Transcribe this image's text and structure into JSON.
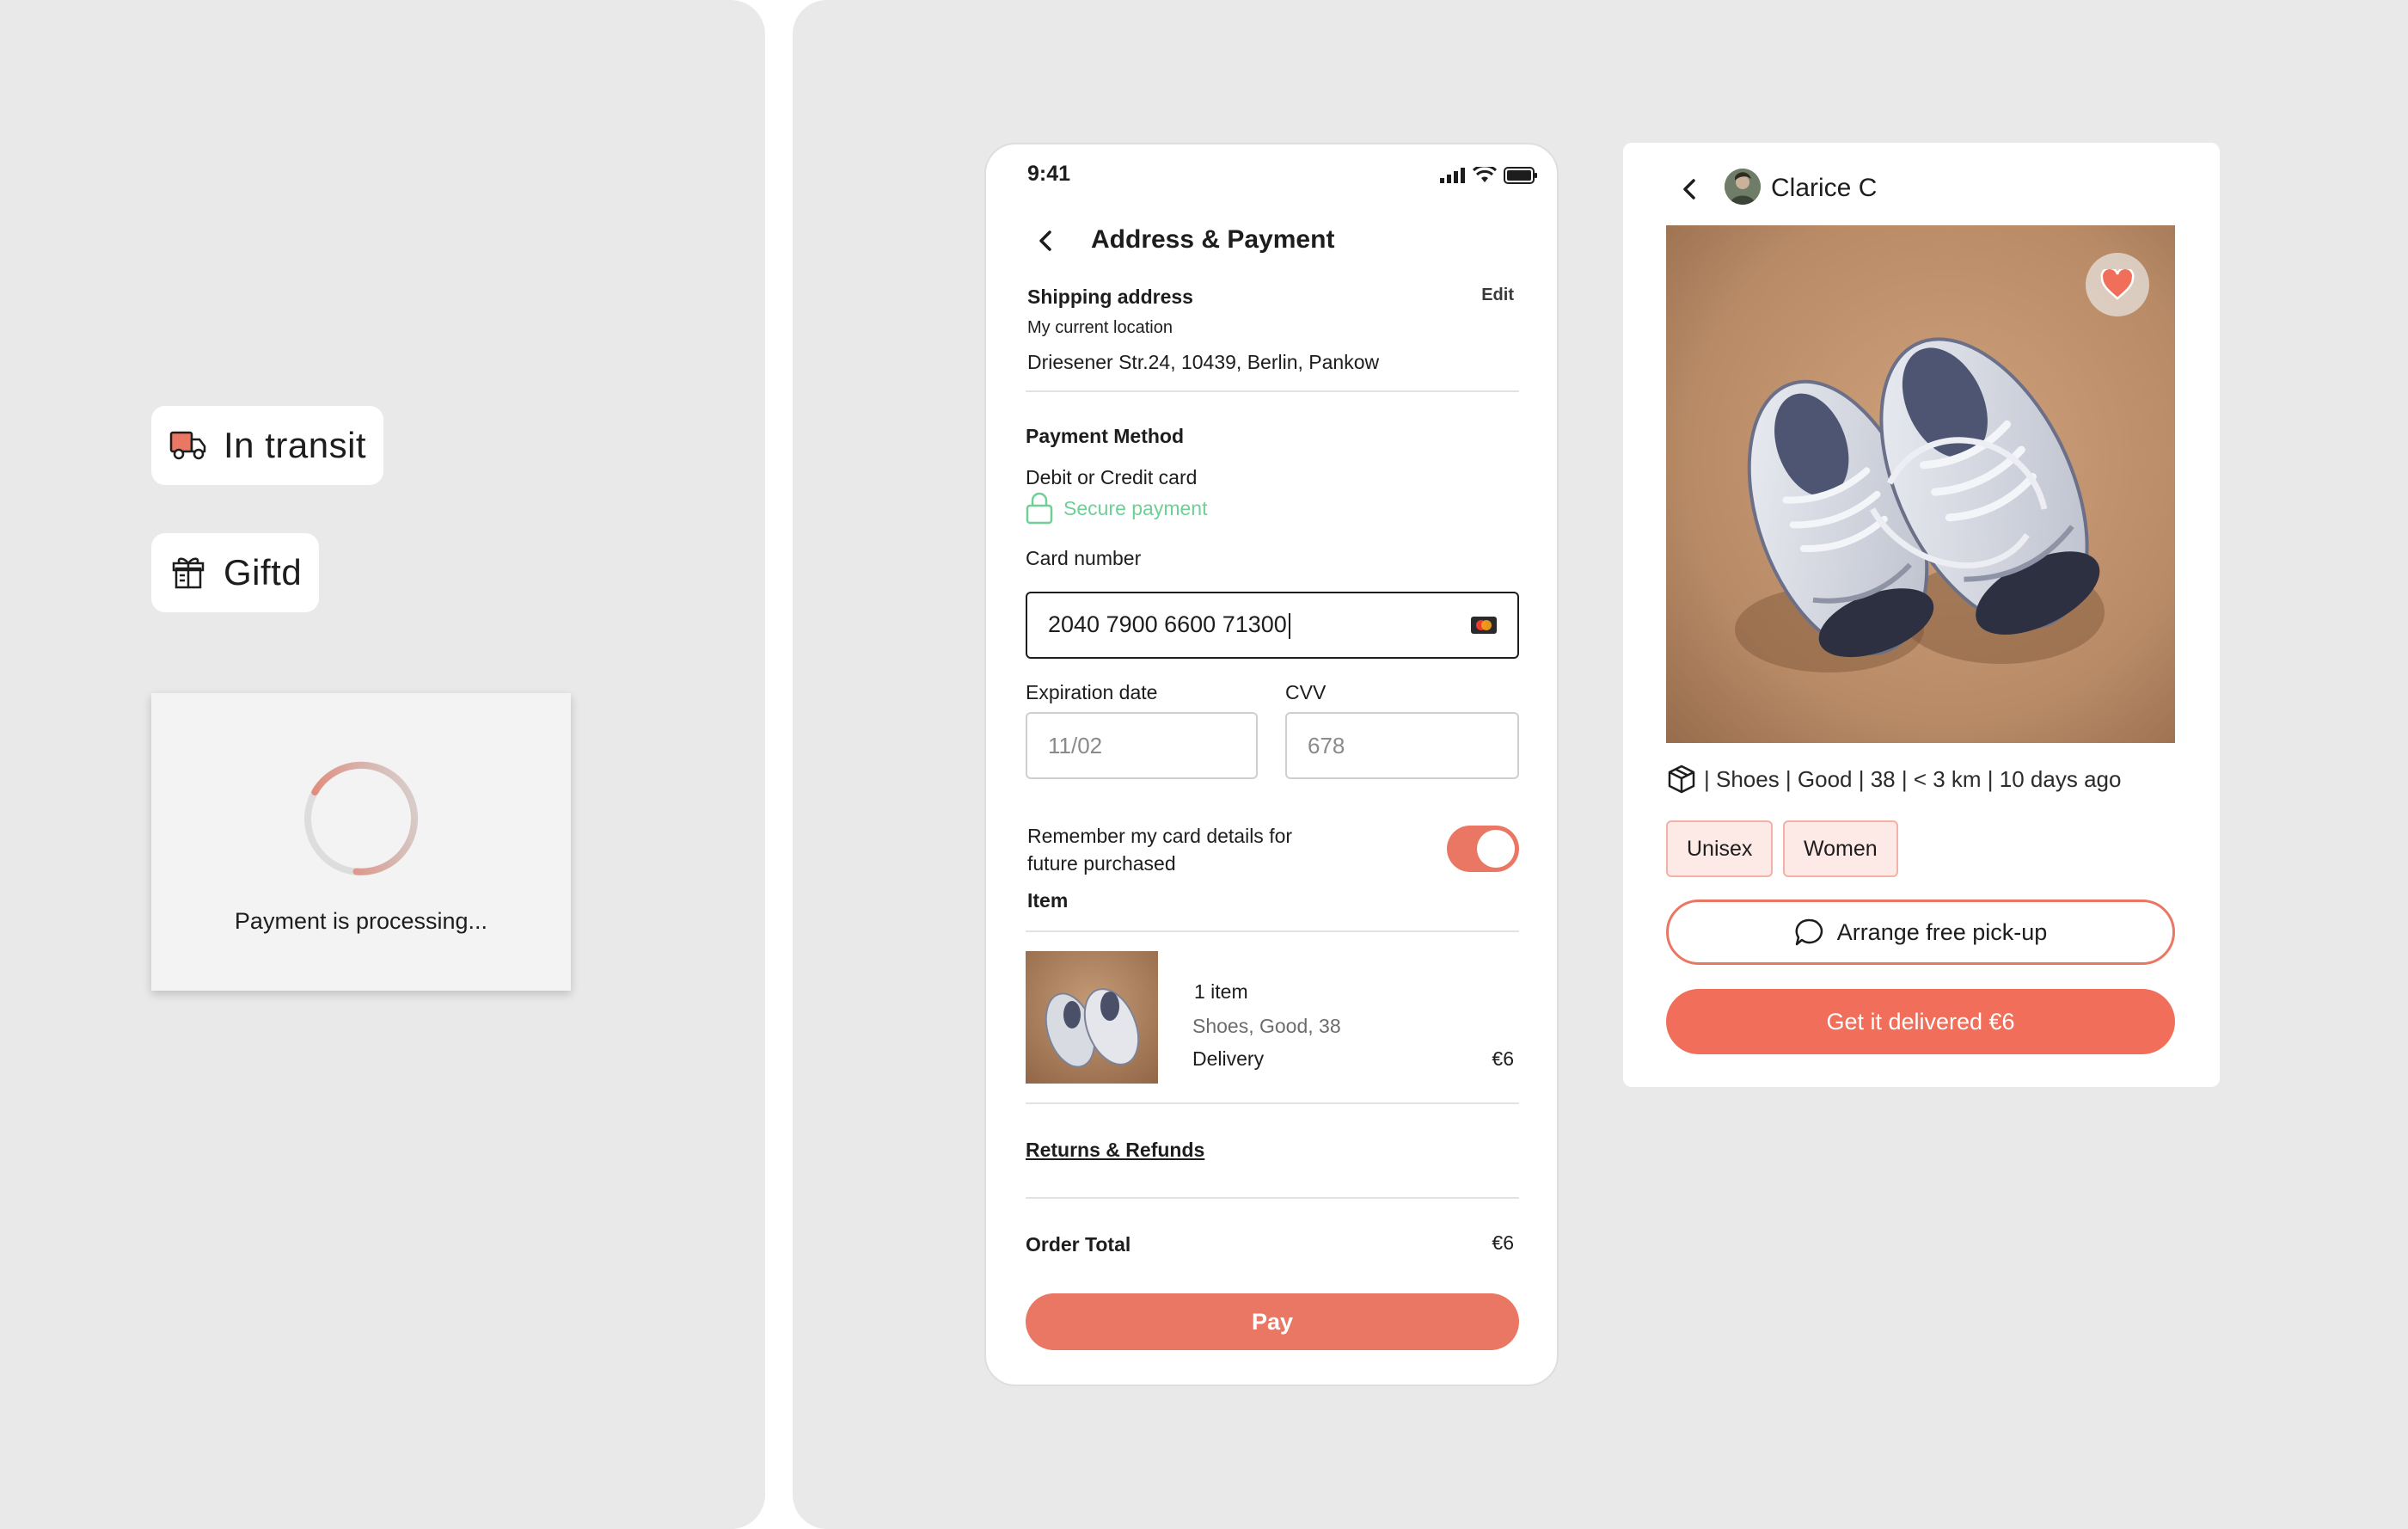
{
  "colors": {
    "background": "#e9e9e9",
    "accent": "#ea7764",
    "accent_strong": "#f16e5a",
    "secure_green": "#6fcf97",
    "tag_bg": "#fde9e5"
  },
  "status_chips": {
    "in_transit": {
      "label": "In transit",
      "icon": "truck-icon"
    },
    "gifted": {
      "label": "Giftd",
      "icon": "gift-icon"
    }
  },
  "processing": {
    "message": "Payment is processing..."
  },
  "phone": {
    "status_bar": {
      "time": "9:41"
    },
    "title": "Address & Payment",
    "shipping": {
      "heading": "Shipping address",
      "edit_label": "Edit",
      "location_label": "My current location",
      "address": "Driesener Str.24, 10439, Berlin, Pankow"
    },
    "payment": {
      "heading": "Payment Method",
      "method": "Debit or Credit card",
      "secure_label": "Secure payment",
      "card_number_label": "Card number",
      "card_number_value": "2040 7900 6600 71300",
      "expiration_label": "Expiration date",
      "expiration_value": "11/02",
      "cvv_label": "CVV",
      "cvv_value": "678",
      "remember_label_line1": "Remember my card details for",
      "remember_label_line2": "future purchased",
      "remember_enabled": true
    },
    "item": {
      "heading": "Item",
      "count": "1 item",
      "description": "Shoes, Good, 38",
      "delivery_label": "Delivery",
      "delivery_price": "€6"
    },
    "returns_link": "Returns & Refunds",
    "order_total_label": "Order Total",
    "order_total_value": "€6",
    "pay_button": "Pay"
  },
  "product": {
    "seller": "Clarice C",
    "favorited": true,
    "meta": "| Shoes | Good | 38 | < 3 km | 10 days ago",
    "tags": [
      "Unisex",
      "Women"
    ],
    "pickup_button": "Arrange free pick-up",
    "delivery_button": "Get it delivered €6"
  }
}
